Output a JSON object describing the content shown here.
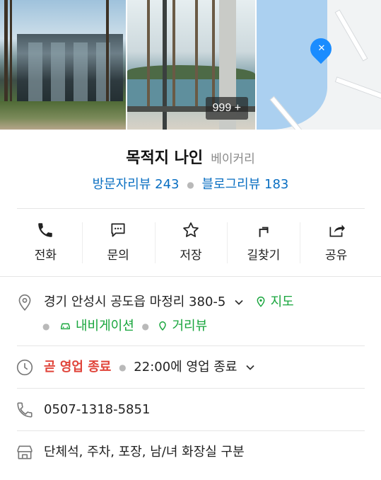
{
  "photos": {
    "more_count": "999 +"
  },
  "place": {
    "name": "목적지 나인",
    "category": "베이커리"
  },
  "reviews": {
    "visitor": "방문자리뷰 243",
    "blog": "블로그리뷰 183"
  },
  "actions": [
    {
      "label": "전화",
      "icon": "phone-icon"
    },
    {
      "label": "문의",
      "icon": "chat-icon"
    },
    {
      "label": "저장",
      "icon": "star-icon"
    },
    {
      "label": "길찾기",
      "icon": "directions-icon"
    },
    {
      "label": "공유",
      "icon": "share-icon"
    }
  ],
  "address": {
    "text": "경기 안성시 공도읍 마정리 380-5",
    "map_link": "지도",
    "nav_link": "내비게이션",
    "street_link": "거리뷰"
  },
  "hours": {
    "status": "곧 영업 종료",
    "detail": "22:00에 영업 종료"
  },
  "phone": {
    "number": "0507-1318-5851"
  },
  "amenities": {
    "text": "단체석, 주차, 포장, 남/녀 화장실 구분"
  },
  "colors": {
    "accent_blue": "#0a6fc2",
    "green": "#17a53c",
    "red": "#e0443a",
    "pin": "#1a8cff"
  }
}
